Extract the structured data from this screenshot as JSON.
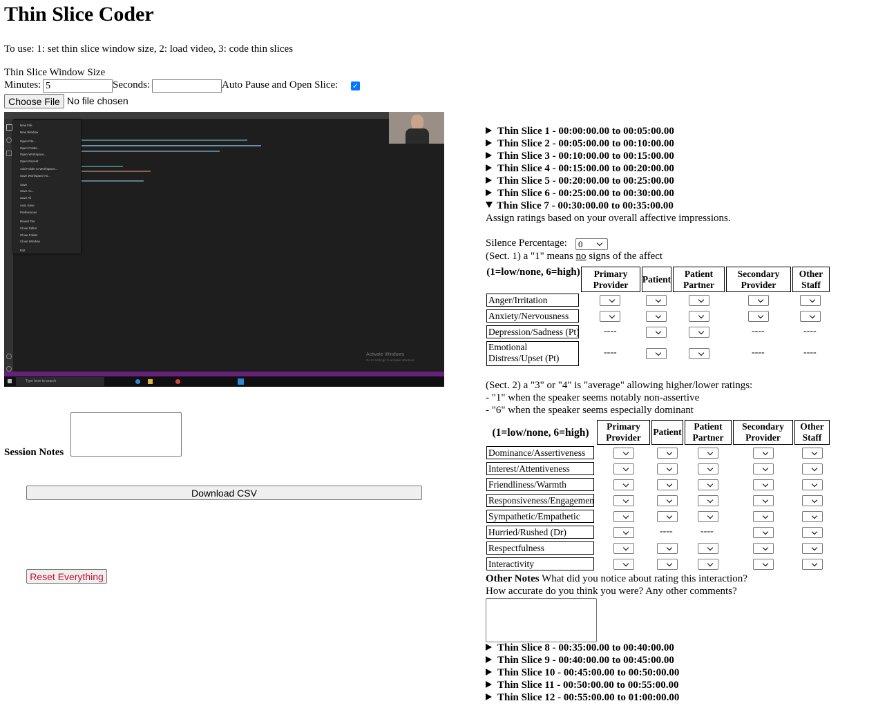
{
  "title": "Thin Slice Coder",
  "instructions": "To use: 1: set thin slice window size, 2: load video, 3: code thin slices",
  "window_size": {
    "label": "Thin Slice Window Size",
    "minutes_label": "Minutes:",
    "minutes_value": "5",
    "seconds_label": "Seconds:",
    "seconds_value": "",
    "auto_pause_label": "Auto Pause and Open Slice:",
    "auto_pause_checked": true
  },
  "file": {
    "button": "Choose File",
    "status": "No file chosen"
  },
  "video": {
    "menu_items": [
      "New File",
      "New Window",
      "Open File...",
      "Open Folder...",
      "Open Workspace...",
      "Open Recent",
      "Add Folder to Workspace...",
      "Save Workspace As...",
      "Save",
      "Save As...",
      "Save All",
      "Auto Save",
      "Preferences",
      "Revert File",
      "Close Editor",
      "Close Folder",
      "Close Window",
      "Exit"
    ],
    "watermark_title": "Activate Windows",
    "watermark_sub": "Go to Settings to activate Windows.",
    "taskbar_search": "Type here to search"
  },
  "session_notes_label": "Session Notes",
  "download_button": "Download CSV",
  "reset_button": "Reset Everything",
  "slices_before": [
    {
      "num": "Thin Slice 1",
      "range": " - 00:00:00.00 to 00:05:00.00"
    },
    {
      "num": "Thin Slice 2",
      "range": " - 00:05:00.00 to 00:10:00.00"
    },
    {
      "num": "Thin Slice 3",
      "range": " - 00:10:00.00 to 00:15:00.00"
    },
    {
      "num": "Thin Slice 4",
      "range": " - 00:15:00.00 to 00:20:00.00"
    },
    {
      "num": "Thin Slice 5",
      "range": " - 00:20:00.00 to 00:25:00.00"
    },
    {
      "num": "Thin Slice 6",
      "range": " - 00:25:00.00 to 00:30:00.00"
    }
  ],
  "open_slice": {
    "num": "Thin Slice 7",
    "range": " - 00:30:00.00 to 00:35:00.00"
  },
  "assign_text": "Assign ratings based on your overall affective impressions.",
  "silence_label": "Silence Percentage:",
  "silence_value": "0",
  "sect1": {
    "intro_pre": "(Sect. 1) a \"1\" means ",
    "intro_no": "no",
    "intro_post": " signs of the affect",
    "scale": "(1=low/none, 6=high)",
    "columns": [
      "Primary Provider",
      "Patient",
      "Patient Partner",
      "Secondary Provider",
      "Other Staff"
    ],
    "rows": [
      "Anger/Irritation",
      "Anxiety/Nervousness",
      "Depression/Sadness (Pt)",
      "Emotional Distress/Upset (Pt)"
    ],
    "dash": "----"
  },
  "sect2": {
    "line1": "(Sect. 2) a \"3\" or \"4\" is \"average\" allowing higher/lower ratings:",
    "line2": "- \"1\" when the speaker seems notably non-assertive",
    "line3": "- \"6\" when the speaker seems especially dominant",
    "scale": "(1=low/none, 6=high)",
    "columns": [
      "Primary Provider",
      "Patient",
      "Patient Partner",
      "Secondary Provider",
      "Other Staff"
    ],
    "rows": [
      "Dominance/Assertiveness",
      "Interest/Attentiveness",
      "Friendliness/Warmth",
      "Responsiveness/Engagement",
      "Sympathetic/Empathetic",
      "Hurried/Rushed (Dr)",
      "Respectfulness",
      "Interactivity"
    ],
    "dash": "----"
  },
  "other_notes": {
    "label": "Other Notes",
    "text1": " What did you notice about rating this interaction?",
    "text2": "How accurate do you think you were? Any other comments?"
  },
  "slices_after": [
    {
      "num": "Thin Slice 8",
      "range": " - 00:35:00.00 to 00:40:00.00"
    },
    {
      "num": "Thin Slice 9",
      "range": " - 00:40:00.00 to 00:45:00.00"
    },
    {
      "num": "Thin Slice 10",
      "range": " - 00:45:00.00 to 00:50:00.00"
    },
    {
      "num": "Thin Slice 11",
      "range": " - 00:50:00.00 to 00:55:00.00"
    },
    {
      "num": "Thin Slice 12",
      "range": " - 00:55:00.00 to 01:00:00.00"
    }
  ],
  "colors": {
    "checkbox": "#0075ff",
    "reset_text": "#c8102e",
    "video_bg": "#1e1e1e",
    "statusbar": "#68217a"
  }
}
